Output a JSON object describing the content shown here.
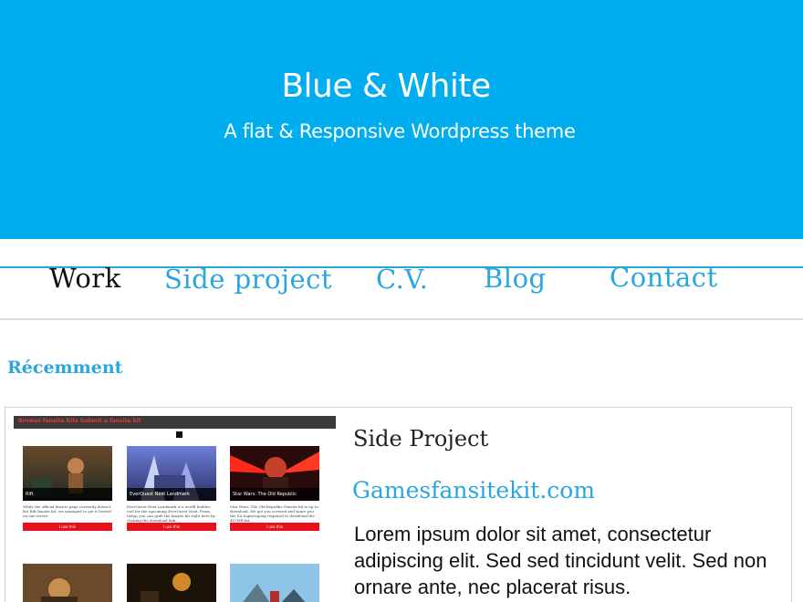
{
  "header": {
    "title": "Blue & White",
    "tagline": "A flat & Responsive Wordpress theme",
    "background": "#00aeef"
  },
  "nav": {
    "items": [
      {
        "label": "Work",
        "active": true
      },
      {
        "label": "Side project",
        "active": false
      },
      {
        "label": "C.V.",
        "active": false
      },
      {
        "label": "Blog",
        "active": false
      },
      {
        "label": "Contact",
        "active": false
      }
    ],
    "accent": "#2aa6df"
  },
  "section": {
    "title": "Récemment"
  },
  "card": {
    "kicker": "Side Project",
    "link": "Gamesfansitekit.com",
    "text": "Lorem ipsum dolor sit amet, consectetur adipiscing elit. Sed sed tincidunt velit. Sed non ornare ante, nec placerat risus.",
    "thumbnail": {
      "bar_text": "Browse fansite Kits    Submit a fansite kit",
      "tiles": [
        {
          "caption": "Rift",
          "desc": "While the official fansite page currently doesn't list Rift fansite kit, we managed to get it hosted on our server.",
          "button": "I use this"
        },
        {
          "caption": "EverQuest Next Landmark",
          "desc": "EverQuest Next Landmark is a world builder tool for the upcoming EverQuest Next. From today, you can grab the fansite kit right here by clicking the download link.",
          "button": "I use this"
        },
        {
          "caption": "Star Wars: The Old Republic",
          "desc": "Star Wars: The Old Republic Fansite kit is up to download. We got you covered and spare you the EA login/signup required to download the 407MB kit.",
          "button": "I use this"
        }
      ]
    }
  }
}
